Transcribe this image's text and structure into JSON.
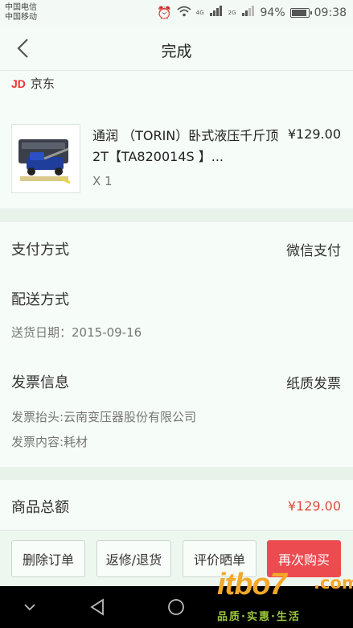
{
  "status_bar": {
    "carrier_1": "中国电信",
    "carrier_2": "中国移动",
    "network_1": "4G",
    "network_2": "2G",
    "battery": "94%",
    "time": "09:38"
  },
  "header": {
    "title": "完成"
  },
  "store": {
    "logo": "JD",
    "name": "京东",
    "product": {
      "name": "通润 （TORIN）卧式液压千斤顶 2T【TA820014S 】...",
      "price": "¥129.00",
      "quantity": "X 1"
    }
  },
  "order_info": {
    "payment_label": "支付方式",
    "payment_value": "微信支付",
    "delivery_label": "配送方式",
    "delivery_date": "送货日期：2015-09-16",
    "invoice_label": "发票信息",
    "invoice_type": "纸质发票",
    "invoice_title": "发票抬头:云南变压器股份有限公司",
    "invoice_content": "发票内容:耗材"
  },
  "total": {
    "label": "商品总额",
    "value": "¥129.00"
  },
  "actions": {
    "delete": "删除订单",
    "return": "返修/退货",
    "review": "评价晒单",
    "rebuy": "再次购买"
  },
  "watermark": {
    "brand": "itbo7",
    "domain": ".com",
    "tagline": "品质·实惠·生活"
  },
  "colors": {
    "accent": "#ec4b50",
    "price_red": "#e04b3a",
    "jd_red": "#e33333"
  }
}
